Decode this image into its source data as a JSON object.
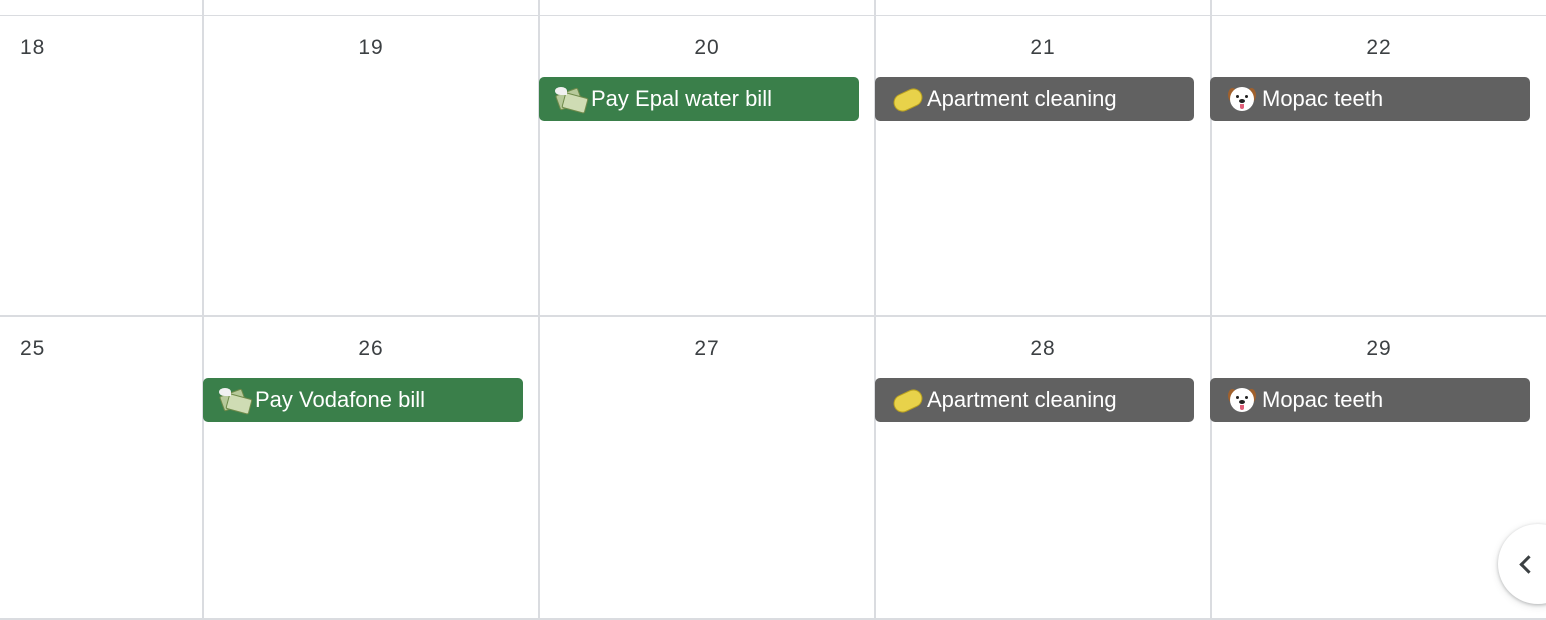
{
  "colors": {
    "grid": "#dadce0",
    "text": "#3c4043",
    "green_event": "#3a7f4a",
    "gray_event": "#616161"
  },
  "weeks": [
    {
      "days": [
        {
          "number": "18"
        },
        {
          "number": "19"
        },
        {
          "number": "20"
        },
        {
          "number": "21"
        },
        {
          "number": "22"
        }
      ],
      "events": [
        {
          "label": "Pay Epal water bill",
          "icon": "money-with-wings-icon",
          "color": "#3a7f4a"
        },
        {
          "label": "Apartment cleaning",
          "icon": "sponge-icon",
          "color": "#616161"
        },
        {
          "label": "Mopac teeth",
          "icon": "dog-face-icon",
          "color": "#616161"
        }
      ]
    },
    {
      "days": [
        {
          "number": "25"
        },
        {
          "number": "26"
        },
        {
          "number": "27"
        },
        {
          "number": "28"
        },
        {
          "number": "29"
        }
      ],
      "events": [
        {
          "label": "Pay Vodafone bill",
          "icon": "money-with-wings-icon",
          "color": "#3a7f4a"
        },
        {
          "label": "Apartment cleaning",
          "icon": "sponge-icon",
          "color": "#616161"
        },
        {
          "label": "Mopac teeth",
          "icon": "dog-face-icon",
          "color": "#616161"
        }
      ]
    }
  ],
  "side_panel_toggle": {
    "icon": "chevron-left-icon"
  }
}
